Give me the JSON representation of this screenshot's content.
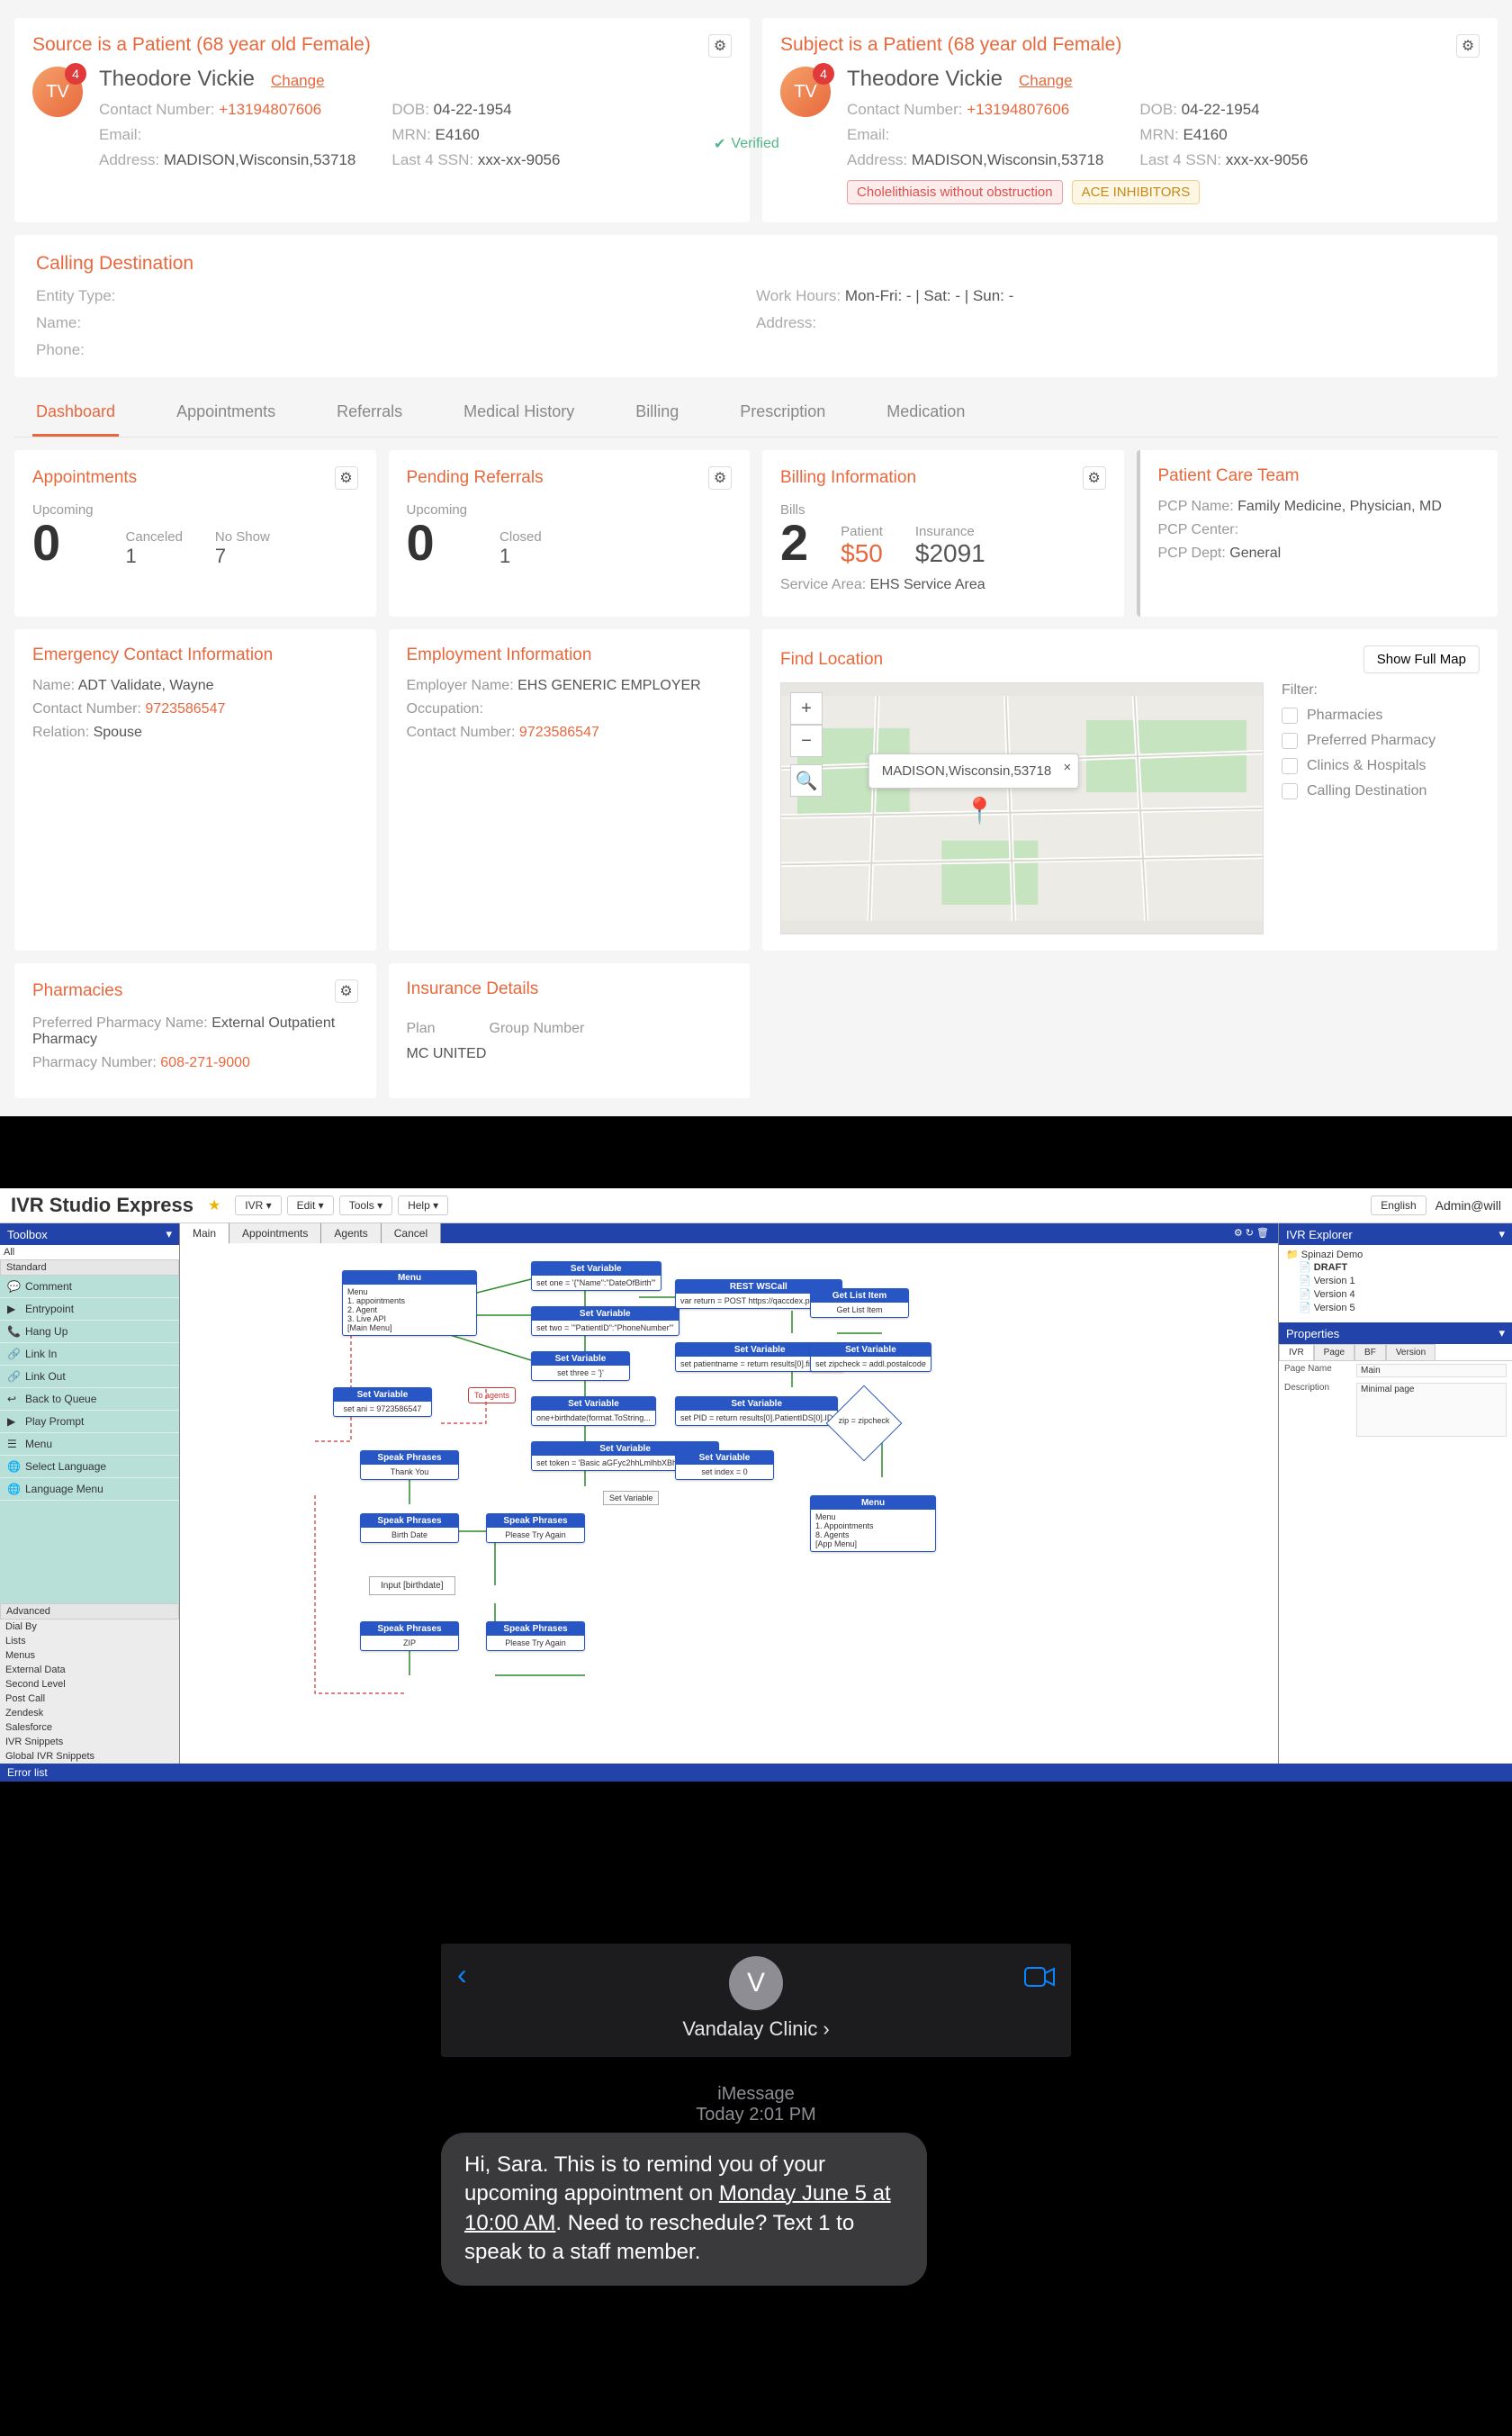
{
  "ehr": {
    "source_card": {
      "title": "Source is a Patient (68 year old Female)",
      "initials": "TV",
      "badge": "4",
      "name": "Theodore Vickie",
      "change": "Change",
      "contact_label": "Contact Number:",
      "contact": "+13194807606",
      "email_label": "Email:",
      "email": "",
      "address_label": "Address:",
      "address": "MADISON,Wisconsin,53718",
      "dob_label": "DOB:",
      "dob": "04-22-1954",
      "mrn_label": "MRN:",
      "mrn": "E4160",
      "ssn_label": "Last 4 SSN:",
      "ssn": "xxx-xx-9056"
    },
    "subject_card": {
      "title": "Subject is a Patient (68 year old Female)",
      "verified": "Verified",
      "tag1": "Cholelithiasis without obstruction",
      "tag2": "ACE INHIBITORS"
    },
    "calling": {
      "title": "Calling Destination",
      "entity_label": "Entity Type:",
      "name_label": "Name:",
      "phone_label": "Phone:",
      "work_label": "Work Hours:",
      "work_val": "Mon-Fri: - | Sat: - | Sun: -",
      "address_label": "Address:"
    },
    "tabs": [
      "Dashboard",
      "Appointments",
      "Referrals",
      "Medical History",
      "Billing",
      "Prescription",
      "Medication"
    ],
    "cards": {
      "appointments": {
        "title": "Appointments",
        "upcoming_label": "Upcoming",
        "upcoming": "0",
        "canceled_label": "Canceled",
        "canceled": "1",
        "noshow_label": "No Show",
        "noshow": "7"
      },
      "pending": {
        "title": "Pending Referrals",
        "upcoming_label": "Upcoming",
        "upcoming": "0",
        "closed_label": "Closed",
        "closed": "1"
      },
      "billing": {
        "title": "Billing Information",
        "bills_label": "Bills",
        "bills": "2",
        "patient_label": "Patient",
        "patient": "$50",
        "insurance_label": "Insurance",
        "insurance": "$2091",
        "svc_label": "Service Area:",
        "svc": "EHS Service Area"
      },
      "team": {
        "title": "Patient Care Team",
        "pcp_name_label": "PCP Name:",
        "pcp_name": "Family Medicine, Physician, MD",
        "pcp_center_label": "PCP Center:",
        "pcp_dept_label": "PCP Dept:",
        "pcp_dept": "General"
      },
      "emergency": {
        "title": "Emergency Contact Information",
        "name_label": "Name:",
        "name": "ADT Validate, Wayne",
        "contact_label": "Contact Number:",
        "contact": "9723586547",
        "rel_label": "Relation:",
        "rel": "Spouse"
      },
      "employment": {
        "title": "Employment Information",
        "emp_label": "Employer Name:",
        "emp": "EHS GENERIC EMPLOYER",
        "occ_label": "Occupation:",
        "cn_label": "Contact Number:",
        "cn": "9723586547"
      },
      "pharmacies": {
        "title": "Pharmacies",
        "pref_label": "Preferred Pharmacy Name:",
        "pref": "External Outpatient Pharmacy",
        "num_label": "Pharmacy Number:",
        "num": "608-271-9000"
      },
      "insurance": {
        "title": "Insurance Details",
        "plan_label": "Plan",
        "group_label": "Group Number",
        "plan": "MC UNITED"
      },
      "location": {
        "title": "Find Location",
        "btn": "Show Full Map",
        "popup": "MADISON,Wisconsin,53718",
        "filter_label": "Filter:",
        "filters": [
          "Pharmacies",
          "Preferred Pharmacy",
          "Clinics & Hospitals",
          "Calling Destination"
        ]
      }
    }
  },
  "ivr": {
    "title": "IVR Studio Express",
    "menus": [
      "IVR ▾",
      "Edit ▾",
      "Tools ▾",
      "Help ▾"
    ],
    "lang": "English",
    "user": "Admin@will",
    "toolbox_title": "Toolbox",
    "tab_all": "All",
    "group_standard": "Standard",
    "tools": [
      "Comment",
      "Entrypoint",
      "Hang Up",
      "Link In",
      "Link Out",
      "Back to Queue",
      "Play Prompt",
      "Menu",
      "Select Language",
      "Language Menu"
    ],
    "group_advanced": "Advanced",
    "adv": [
      "Dial By",
      "Lists",
      "Menus",
      "External Data",
      "Second Level",
      "Post Call",
      "Zendesk",
      "Salesforce",
      "IVR Snippets",
      "Global IVR Snippets"
    ],
    "canvas_tabs": [
      "Main",
      "Appointments",
      "Agents",
      "Cancel"
    ],
    "explorer_title": "IVR Explorer",
    "tree_root": "Spinazi Demo",
    "tree_items": [
      "DRAFT",
      "Version 1",
      "Version 4",
      "Version 5"
    ],
    "props_title": "Properties",
    "props_tabs": [
      "IVR",
      "Page",
      "BF",
      "Version"
    ],
    "prop_page_k": "Page Name",
    "prop_page_v": "Main",
    "prop_desc_k": "Description",
    "prop_desc_v": "Minimal page",
    "error_title": "Error list",
    "nodes": {
      "menu1": {
        "hdr": "Menu",
        "body": "Menu\n1. appointments\n2. Agent\n3. Live API\n[Main Menu]"
      },
      "sv1": {
        "hdr": "Set Variable",
        "body": "set one = '{\"Name\":\"DateOfBirth\"'"
      },
      "sv2": {
        "hdr": "Set Variable",
        "body": "set two = '\"PatientID\":\"PhoneNumber\"'"
      },
      "sv3": {
        "hdr": "Set Variable",
        "body": "set three = '}'"
      },
      "sv4": {
        "hdr": "Set Variable",
        "body": "set ani = 9723586547"
      },
      "sv5": {
        "hdr": "Set Variable",
        "body": "one+birthdate(format.ToString..."
      },
      "sv6": {
        "hdr": "Set Variable",
        "body": "set token = 'Basic aGFyc2hhLmlhbXBhdGk6SE..."
      },
      "sv7": {
        "hdr": "Set Variable",
        "body": "set index = 0"
      },
      "sv8": {
        "hdr": "Set Variable",
        "body": "set patientname = return results[0].firstname"
      },
      "sv9": {
        "hdr": "Set Variable",
        "body": "set PID = return results[0].PatientIDS[0].ID"
      },
      "sv10": {
        "hdr": "Set Variable",
        "body": "set zipcheck = addl.postalcode"
      },
      "rest": {
        "hdr": "REST WSCall",
        "body": "var return = POST https://qaccdex.patiern..."
      },
      "gl1": {
        "hdr": "Get List Item",
        "body": "Get List Item"
      },
      "sp1": {
        "hdr": "Speak Phrases",
        "body": "Thank You"
      },
      "sp2": {
        "hdr": "Speak Phrases",
        "body": "Birth Date"
      },
      "sp3": {
        "hdr": "Speak Phrases",
        "body": "Please Try Again"
      },
      "sp4": {
        "hdr": "Speak Phrases",
        "body": "ZIP"
      },
      "sp5": {
        "hdr": "Speak Phrases",
        "body": "Please Try Again"
      },
      "menu2": {
        "hdr": "Menu",
        "body": "Menu\n1. Appointments\n8. Agents\n[App Menu]"
      },
      "input": {
        "hdr": "",
        "body": "Input [birthdate]"
      },
      "toagents": "To agents",
      "setvarbtn": "Set Variable",
      "zip": "zip = zipcheck"
    }
  },
  "imsg": {
    "sender": "Vandalay Clinic",
    "avatar": "V",
    "meta1": "iMessage",
    "meta2": "Today 2:01 PM",
    "text_pre": "Hi, Sara. This is to remind you of your upcoming appointment on ",
    "text_u": "Monday June 5 at 10:00 AM",
    "text_post": ". Need to reschedule? Text 1 to speak to a staff member."
  }
}
